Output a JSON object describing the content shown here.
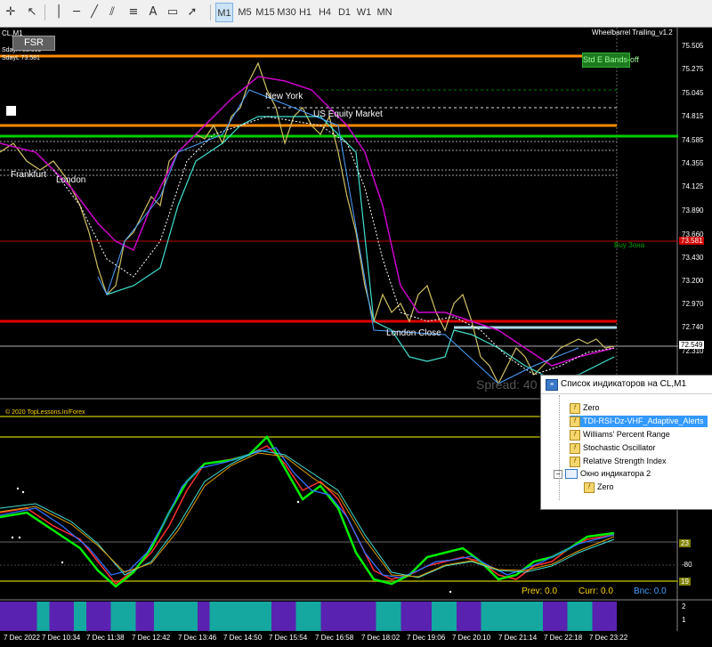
{
  "toolbar": {
    "timeframes": [
      "M1",
      "M5",
      "M15",
      "M30",
      "H1",
      "H4",
      "D1",
      "W1",
      "MN"
    ],
    "selected": "M1"
  },
  "chart": {
    "symbol": "CL,M1",
    "indicator_name": "Wheelbarrel Trailing_v1.2",
    "sday_h": "SdayH 83.609",
    "sday_l": "SdayL 73.581",
    "fsr_button": "FSR",
    "std_bands_button": "Std E Bands-off",
    "sessions": [
      "New York",
      "US Equity Market",
      "Frankfurt",
      "London",
      "London Close"
    ],
    "buy_zone": "Buy Зона",
    "copyright": "© 2020 TopLessons.In/Forex",
    "spread": "Spread: 40",
    "current_price": "72.549",
    "red_price": "73.581",
    "price_ticks": [
      "75.505",
      "75.275",
      "75.045",
      "74.815",
      "74.585",
      "74.355",
      "74.125",
      "73.890",
      "73.660",
      "73.430",
      "73.200",
      "72.970",
      "72.740",
      "72.310"
    ],
    "sub_ticks": [
      "-80",
      "2",
      "1"
    ],
    "sub_tag_top": "23",
    "sub_tag_bottom": "19",
    "prev": "Prev: 0.0",
    "curr": "Curr: 0.0",
    "bnc": "Bnc: 0.0",
    "time_labels": [
      "7 Dec 2022",
      "7 Dec 10:34",
      "7 Dec 11:38",
      "7 Dec 12:42",
      "7 Dec 13:46",
      "7 Dec 14:50",
      "7 Dec 15:54",
      "7 Dec 16:58",
      "7 Dec 18:02",
      "7 Dec 19:06",
      "7 Dec 20:10",
      "7 Dec 21:14",
      "7 Dec 22:18",
      "7 Dec 23:22"
    ]
  },
  "dialog": {
    "title": "Список индикаторов на CL,M1",
    "items": [
      "Zero",
      "TDI-RSI-Dz-VHF_Adaptive_Alerts",
      "Williams' Percent Range",
      "Stochastic Oscillator",
      "Relative Strength Index",
      "Окно индикатора 2",
      "Zero"
    ]
  },
  "colors": {
    "orange": "#ff8c00",
    "green": "#00cc00",
    "red": "#e00000",
    "light_blue": "#add8e6",
    "magenta": "#cc00cc",
    "cyan": "#40e0d0",
    "olive": "#808000",
    "purple": "#5a22b0",
    "teal": "#14a8a0"
  }
}
